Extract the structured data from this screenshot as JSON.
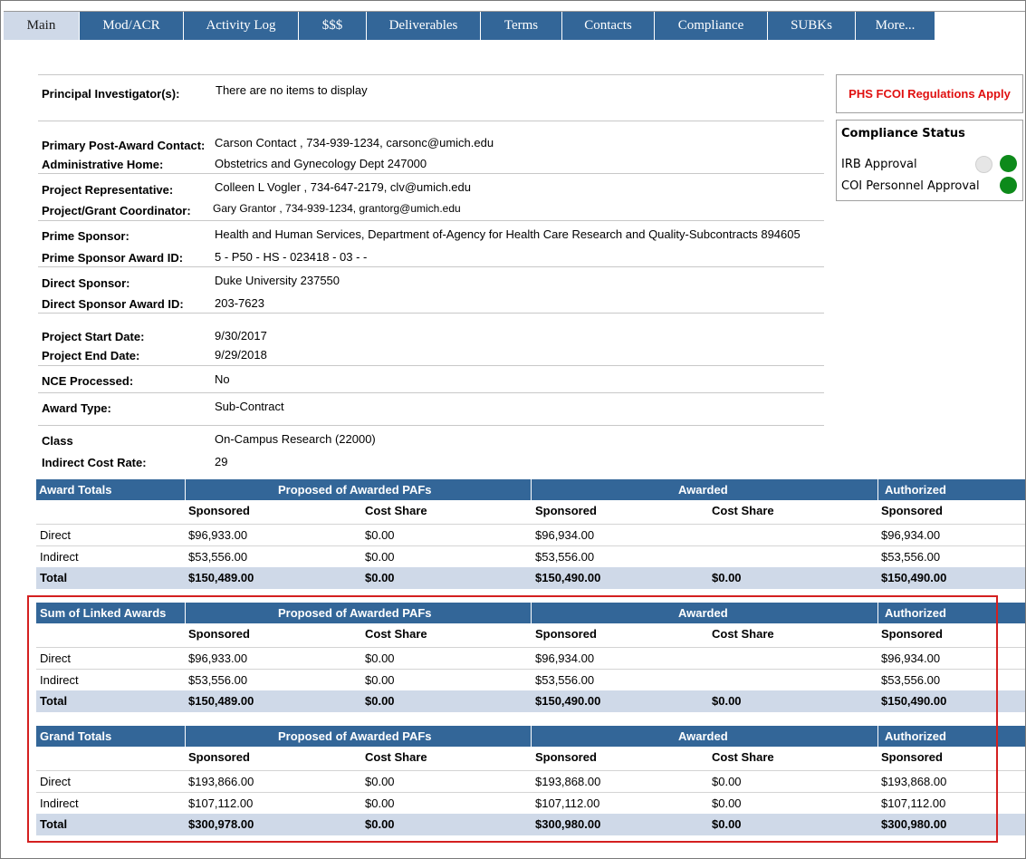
{
  "tabs": [
    "Main",
    "Mod/ACR",
    "Activity Log",
    "$$$",
    "Deliverables",
    "Terms",
    "Contacts",
    "Compliance",
    "SUBKs",
    "More..."
  ],
  "details": {
    "pi_label": "Principal Investigator(s):",
    "pi_value": "There are no items to display",
    "ppac_label": "Primary Post-Award Contact:",
    "ppac_name": "Carson Contact",
    "ppac_phone": "734-939-1234",
    "ppac_email": "carsonc@umich.edu",
    "admin_home_label": "Administrative Home:",
    "admin_home_value": "Obstetrics and Gynecology Dept   247000",
    "proj_rep_label": "Project Representative:",
    "proj_rep_value": "Colleen L Vogler ,  734-647-2179,  clv@umich.edu",
    "coord_label": "Project/Grant Coordinator:",
    "coord_name": "Gary Grantor",
    "coord_phone": "734-939-1234",
    "coord_email": "grantorg@umich.edu",
    "prime_sponsor_label": "Prime Sponsor:",
    "prime_sponsor_value": "Health and Human Services, Department of-Agency for Health Care Research and Quality-Subcontracts   894605",
    "prime_award_label": "Prime Sponsor Award ID:",
    "prime_award_value": "5 - P50 - HS - 023418  - 03 -  -",
    "direct_sponsor_label": "Direct Sponsor:",
    "direct_sponsor_value": "Duke University   237550",
    "direct_award_label": "Direct Sponsor Award ID:",
    "direct_award_value": "203-7623",
    "start_label": "Project Start Date:",
    "start_value": "9/30/2017",
    "end_label": "Project End Date:",
    "end_value": "9/29/2018",
    "nce_label": "NCE Processed:",
    "nce_value": "No",
    "award_type_label": "Award Type:",
    "award_type_value": "Sub-Contract",
    "class_label": "Class",
    "class_value": "On-Campus Research (22000)",
    "icr_label": "Indirect Cost Rate:",
    "icr_value": "29"
  },
  "phs_notice": "PHS FCOI Regulations Apply",
  "compliance": {
    "title": "Compliance Status",
    "irb": "IRB Approval",
    "coi": "COI Personnel Approval",
    "status_green": "#0d8a1a",
    "status_gray": "#e6e6e6"
  },
  "table_headers": {
    "proposed": "Proposed of Awarded PAFs",
    "awarded": "Awarded",
    "authorized": "Authorized",
    "sponsored": "Sponsored",
    "cost_share": "Cost Share"
  },
  "tables": [
    {
      "title": "Award Totals",
      "rows": [
        {
          "label": "Direct",
          "prop_sp": "$96,933.00",
          "prop_cs": "$0.00",
          "awd_sp": "$96,934.00",
          "awd_cs": "",
          "auth_sp": "$96,934.00"
        },
        {
          "label": "Indirect",
          "prop_sp": "$53,556.00",
          "prop_cs": "$0.00",
          "awd_sp": "$53,556.00",
          "awd_cs": "",
          "auth_sp": "$53,556.00"
        },
        {
          "label": "Total",
          "prop_sp": "$150,489.00",
          "prop_cs": "$0.00",
          "awd_sp": "$150,490.00",
          "awd_cs": "$0.00",
          "auth_sp": "$150,490.00"
        }
      ]
    },
    {
      "title": "Sum of Linked Awards",
      "rows": [
        {
          "label": "Direct",
          "prop_sp": "$96,933.00",
          "prop_cs": "$0.00",
          "awd_sp": "$96,934.00",
          "awd_cs": "",
          "auth_sp": "$96,934.00"
        },
        {
          "label": "Indirect",
          "prop_sp": "$53,556.00",
          "prop_cs": "$0.00",
          "awd_sp": "$53,556.00",
          "awd_cs": "",
          "auth_sp": "$53,556.00"
        },
        {
          "label": "Total",
          "prop_sp": "$150,489.00",
          "prop_cs": "$0.00",
          "awd_sp": "$150,490.00",
          "awd_cs": "$0.00",
          "auth_sp": "$150,490.00"
        }
      ]
    },
    {
      "title": "Grand Totals",
      "rows": [
        {
          "label": "Direct",
          "prop_sp": "$193,866.00",
          "prop_cs": "$0.00",
          "awd_sp": "$193,868.00",
          "awd_cs": "$0.00",
          "auth_sp": "$193,868.00"
        },
        {
          "label": "Indirect",
          "prop_sp": "$107,112.00",
          "prop_cs": "$0.00",
          "awd_sp": "$107,112.00",
          "awd_cs": "$0.00",
          "auth_sp": "$107,112.00"
        },
        {
          "label": "Total",
          "prop_sp": "$300,978.00",
          "prop_cs": "$0.00",
          "awd_sp": "$300,980.00",
          "awd_cs": "$0.00",
          "auth_sp": "$300,980.00"
        }
      ]
    }
  ]
}
